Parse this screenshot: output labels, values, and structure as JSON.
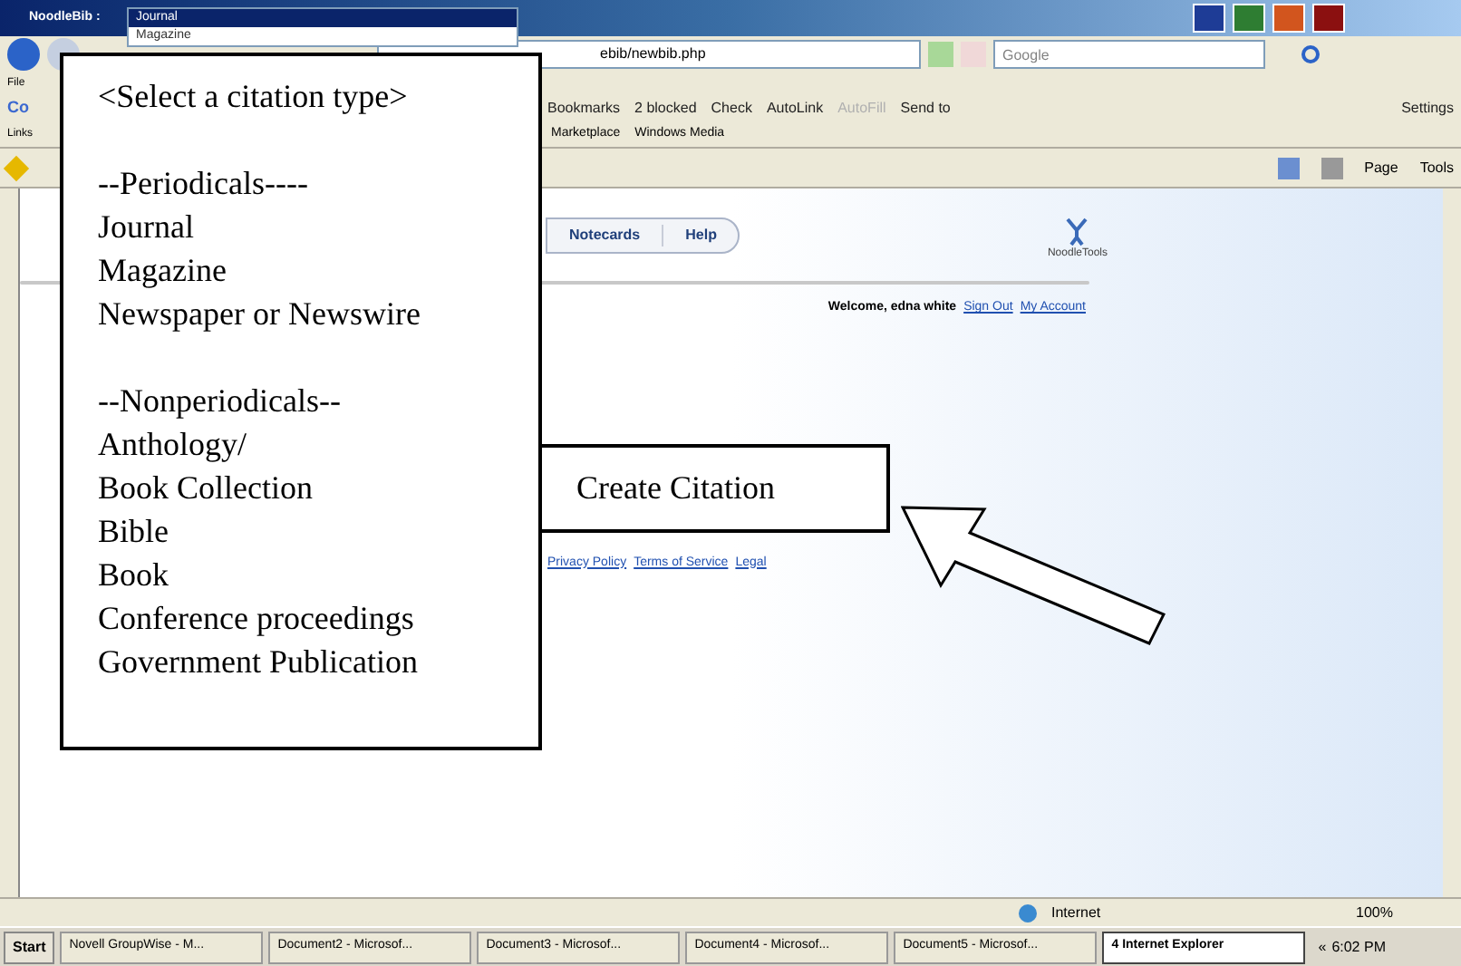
{
  "browser": {
    "title": "NoodleBib :",
    "dropdown": [
      {
        "label": "Journal",
        "selected": true
      },
      {
        "label": "Magazine",
        "selected": false
      }
    ],
    "address": "ebib/newbib.php",
    "search": {
      "placeholder": "Google"
    },
    "menu": [
      "File"
    ],
    "toolbar": {
      "logo": "Co",
      "items": [
        {
          "label": "Bookmarks",
          "disabled": false
        },
        {
          "label": "2 blocked",
          "disabled": false
        },
        {
          "label": "Check",
          "disabled": false
        },
        {
          "label": "AutoLink",
          "disabled": false
        },
        {
          "label": "AutoFill",
          "disabled": true
        },
        {
          "label": "Send to",
          "disabled": false
        },
        {
          "label": "Settings",
          "disabled": false
        }
      ]
    },
    "links": {
      "label": "Links",
      "items": [
        "Marketplace",
        "Windows Media"
      ]
    },
    "command_bar": [
      "Page",
      "Tools"
    ]
  },
  "page": {
    "nav_tabs": [
      "Notecards",
      "Help"
    ],
    "logo": "NoodleTools",
    "welcome": "Welcome, edna white",
    "account_links": [
      "Sign Out",
      "My Account"
    ],
    "footer_links": [
      "Privacy Policy",
      "Terms of Service",
      "Legal"
    ]
  },
  "status_bar": {
    "zone": "Internet",
    "zoom": "100%"
  },
  "taskbar": {
    "start": "Start",
    "tasks": [
      {
        "label": "Novell GroupWise - M...",
        "selected": false
      },
      {
        "label": "Document2 - Microsof...",
        "selected": false
      },
      {
        "label": "Document3 - Microsof...",
        "selected": false
      },
      {
        "label": "Document4 - Microsof...",
        "selected": false
      },
      {
        "label": "Document5 - Microsof...",
        "selected": false
      },
      {
        "label": "4 Internet Explorer",
        "selected": true
      }
    ],
    "tray": "«",
    "clock": "6:02 PM"
  },
  "callouts": {
    "menu_box": [
      [
        "<Select a citation type>"
      ],
      [
        "--Periodicals----",
        "Journal",
        "Magazine",
        "Newspaper or Newswire"
      ],
      [
        "--Nonperiodicals--",
        "Anthology/",
        "Book Collection",
        "Bible",
        "Book",
        "Conference proceedings",
        "Government Publication"
      ]
    ],
    "button_box": "Create Citation"
  }
}
